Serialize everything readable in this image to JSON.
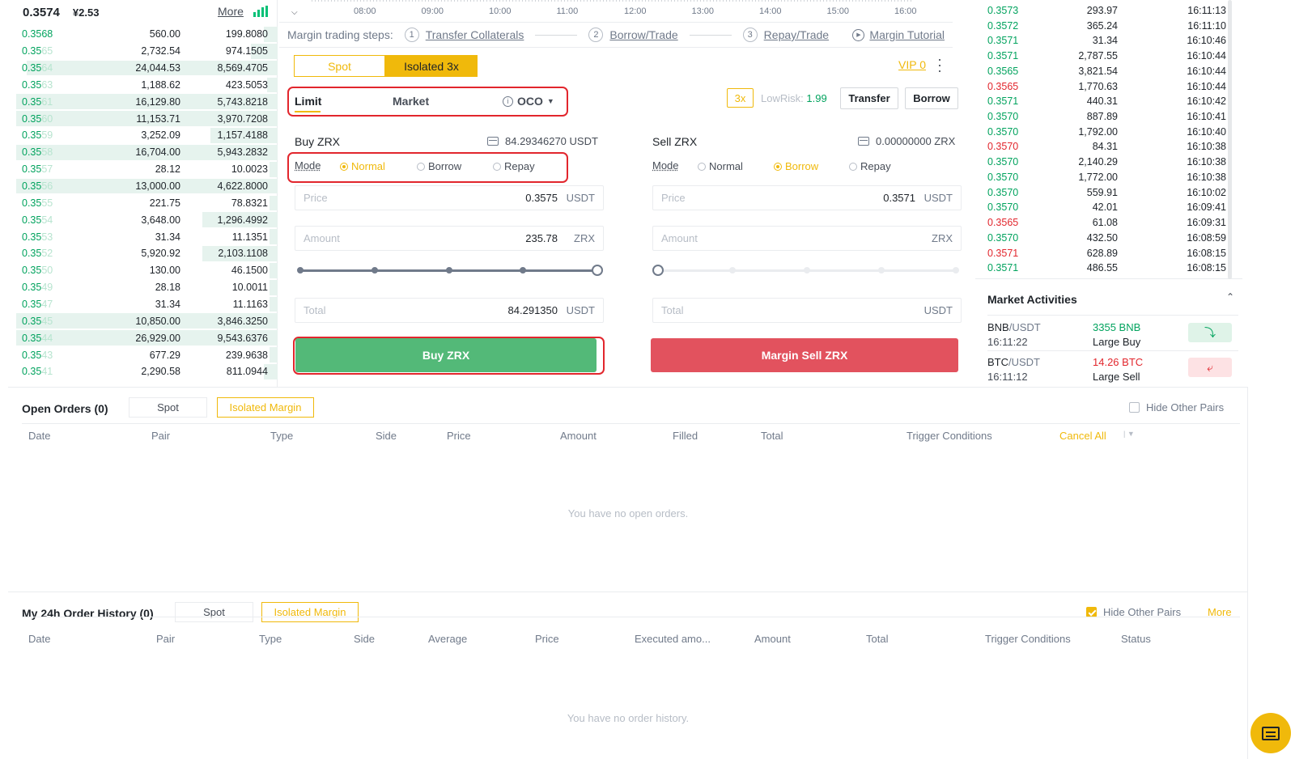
{
  "orderbook": {
    "last_price": "0.3574",
    "cny_price": "¥2.53",
    "more_label": "More",
    "rows": [
      {
        "p_main": "0.3568",
        "p_dim": "",
        "amount": "560.00",
        "total": "199.8080",
        "depth": 0.05
      },
      {
        "p_main": "0.35",
        "p_dim": "65",
        "amount": "2,732.54",
        "total": "974.1505",
        "depth": 0.1
      },
      {
        "p_main": "0.35",
        "p_dim": "64",
        "amount": "24,044.53",
        "total": "8,569.4705",
        "depth": 0.93
      },
      {
        "p_main": "0.35",
        "p_dim": "63",
        "amount": "1,188.62",
        "total": "423.5053",
        "depth": 0.04
      },
      {
        "p_main": "0.35",
        "p_dim": "61",
        "amount": "16,129.80",
        "total": "5,743.8218",
        "depth": 0.97
      },
      {
        "p_main": "0.35",
        "p_dim": "60",
        "amount": "11,153.71",
        "total": "3,970.7208",
        "depth": 0.97
      },
      {
        "p_main": "0.35",
        "p_dim": "59",
        "amount": "3,252.09",
        "total": "1,157.4188",
        "depth": 0.25
      },
      {
        "p_main": "0.35",
        "p_dim": "58",
        "amount": "16,704.00",
        "total": "5,943.2832",
        "depth": 0.97
      },
      {
        "p_main": "0.35",
        "p_dim": "57",
        "amount": "28.12",
        "total": "10.0023",
        "depth": 0.03
      },
      {
        "p_main": "0.35",
        "p_dim": "56",
        "amount": "13,000.00",
        "total": "4,622.8000",
        "depth": 0.97
      },
      {
        "p_main": "0.35",
        "p_dim": "55",
        "amount": "221.75",
        "total": "78.8321",
        "depth": 0.03
      },
      {
        "p_main": "0.35",
        "p_dim": "54",
        "amount": "3,648.00",
        "total": "1,296.4992",
        "depth": 0.28
      },
      {
        "p_main": "0.35",
        "p_dim": "53",
        "amount": "31.34",
        "total": "11.1351",
        "depth": 0.03
      },
      {
        "p_main": "0.35",
        "p_dim": "52",
        "amount": "5,920.92",
        "total": "2,103.1108",
        "depth": 0.28
      },
      {
        "p_main": "0.35",
        "p_dim": "50",
        "amount": "130.00",
        "total": "46.1500",
        "depth": 0.03
      },
      {
        "p_main": "0.35",
        "p_dim": "49",
        "amount": "28.18",
        "total": "10.0011",
        "depth": 0.03
      },
      {
        "p_main": "0.35",
        "p_dim": "47",
        "amount": "31.34",
        "total": "11.1163",
        "depth": 0.03
      },
      {
        "p_main": "0.35",
        "p_dim": "45",
        "amount": "10,850.00",
        "total": "3,846.3250",
        "depth": 0.97
      },
      {
        "p_main": "0.35",
        "p_dim": "44",
        "amount": "26,929.00",
        "total": "9,543.6376",
        "depth": 0.97
      },
      {
        "p_main": "0.35",
        "p_dim": "43",
        "amount": "677.29",
        "total": "239.9638",
        "depth": 0.03
      },
      {
        "p_main": "0.35",
        "p_dim": "41",
        "amount": "2,290.58",
        "total": "811.0944",
        "depth": 0.05
      }
    ]
  },
  "chart": {
    "hours": [
      "08:00",
      "09:00",
      "10:00",
      "11:00",
      "12:00",
      "13:00",
      "14:00",
      "15:00",
      "16:00"
    ]
  },
  "steps": {
    "intro": "Margin trading steps:",
    "items": [
      {
        "num": "1",
        "label": "Transfer Collaterals"
      },
      {
        "num": "2",
        "label": "Borrow/Trade"
      },
      {
        "num": "3",
        "label": "Repay/Trade"
      }
    ],
    "tutorial": "Margin Tutorial"
  },
  "trade": {
    "tabs": {
      "spot": "Spot",
      "isolated": "Isolated 3x"
    },
    "vip": "VIP 0",
    "order_types": {
      "limit": "Limit",
      "market": "Market",
      "oco": "OCO"
    },
    "leverage": "3x",
    "lowrisk_label": "LowRisk:",
    "lowrisk_value": "1.99",
    "transfer": "Transfer",
    "borrow": "Borrow",
    "mode_label": "Mode",
    "mode_options": {
      "normal": "Normal",
      "borrow": "Borrow",
      "repay": "Repay"
    },
    "buy": {
      "title": "Buy ZRX",
      "balance": "84.29346270 USDT",
      "price_label": "Price",
      "price_value": "0.3575",
      "price_unit": "USDT",
      "amount_label": "Amount",
      "amount_value": "235.78",
      "amount_unit": "ZRX",
      "slider_percent": 100,
      "total_label": "Total",
      "total_value": "84.291350",
      "total_unit": "USDT",
      "button": "Buy ZRX"
    },
    "sell": {
      "title": "Sell ZRX",
      "balance": "0.00000000 ZRX",
      "price_label": "Price",
      "price_value": "0.3571",
      "price_unit": "USDT",
      "amount_label": "Amount",
      "amount_value": "",
      "amount_unit": "ZRX",
      "slider_percent": 0,
      "total_label": "Total",
      "total_value": "",
      "total_unit": "USDT",
      "button": "Margin Sell ZRX"
    }
  },
  "trades": [
    {
      "price": "0.3573",
      "amount": "293.97",
      "time": "16:11:13",
      "side": "up"
    },
    {
      "price": "0.3572",
      "amount": "365.24",
      "time": "16:11:10",
      "side": "up"
    },
    {
      "price": "0.3571",
      "amount": "31.34",
      "time": "16:10:46",
      "side": "up"
    },
    {
      "price": "0.3571",
      "amount": "2,787.55",
      "time": "16:10:44",
      "side": "up"
    },
    {
      "price": "0.3565",
      "amount": "3,821.54",
      "time": "16:10:44",
      "side": "up"
    },
    {
      "price": "0.3565",
      "amount": "1,770.63",
      "time": "16:10:44",
      "side": "down"
    },
    {
      "price": "0.3571",
      "amount": "440.31",
      "time": "16:10:42",
      "side": "up"
    },
    {
      "price": "0.3570",
      "amount": "887.89",
      "time": "16:10:41",
      "side": "up"
    },
    {
      "price": "0.3570",
      "amount": "1,792.00",
      "time": "16:10:40",
      "side": "up"
    },
    {
      "price": "0.3570",
      "amount": "84.31",
      "time": "16:10:38",
      "side": "down"
    },
    {
      "price": "0.3570",
      "amount": "2,140.29",
      "time": "16:10:38",
      "side": "up"
    },
    {
      "price": "0.3570",
      "amount": "1,772.00",
      "time": "16:10:38",
      "side": "up"
    },
    {
      "price": "0.3570",
      "amount": "559.91",
      "time": "16:10:02",
      "side": "up"
    },
    {
      "price": "0.3570",
      "amount": "42.01",
      "time": "16:09:41",
      "side": "up"
    },
    {
      "price": "0.3565",
      "amount": "61.08",
      "time": "16:09:31",
      "side": "down"
    },
    {
      "price": "0.3570",
      "amount": "432.50",
      "time": "16:08:59",
      "side": "up"
    },
    {
      "price": "0.3571",
      "amount": "628.89",
      "time": "16:08:15",
      "side": "down"
    },
    {
      "price": "0.3571",
      "amount": "486.55",
      "time": "16:08:15",
      "side": "up"
    }
  ],
  "market_activities": {
    "title": "Market Activities",
    "items": [
      {
        "base": "BNB",
        "quote": "/USDT",
        "time": "16:11:22",
        "amount": "3355 BNB",
        "kind": "Large Buy",
        "side": "buy"
      },
      {
        "base": "BTC",
        "quote": "/USDT",
        "time": "16:11:12",
        "amount": "14.26 BTC",
        "kind": "Large Sell",
        "side": "sell"
      }
    ]
  },
  "open_orders": {
    "title": "Open Orders (0)",
    "tabs": {
      "spot": "Spot",
      "isolated": "Isolated Margin"
    },
    "hide_other": "Hide Other Pairs",
    "hide_checked": false,
    "columns": [
      "Date",
      "Pair",
      "Type",
      "Side",
      "Price",
      "Amount",
      "Filled",
      "Total",
      "Trigger Conditions"
    ],
    "cancel_all": "Cancel All",
    "empty": "You have no open orders."
  },
  "history": {
    "title": "My 24h Order History (0)",
    "tabs": {
      "spot": "Spot",
      "isolated": "Isolated Margin"
    },
    "hide_other": "Hide Other Pairs",
    "hide_checked": true,
    "more": "More",
    "columns": [
      "Date",
      "Pair",
      "Type",
      "Side",
      "Average",
      "Price",
      "Executed amo...",
      "Amount",
      "Total",
      "Trigger Conditions",
      "Status"
    ],
    "empty": "You have no order history."
  },
  "colors": {
    "accent": "#f0b90b",
    "buy": "#02a35e",
    "sell": "#e2262d"
  }
}
